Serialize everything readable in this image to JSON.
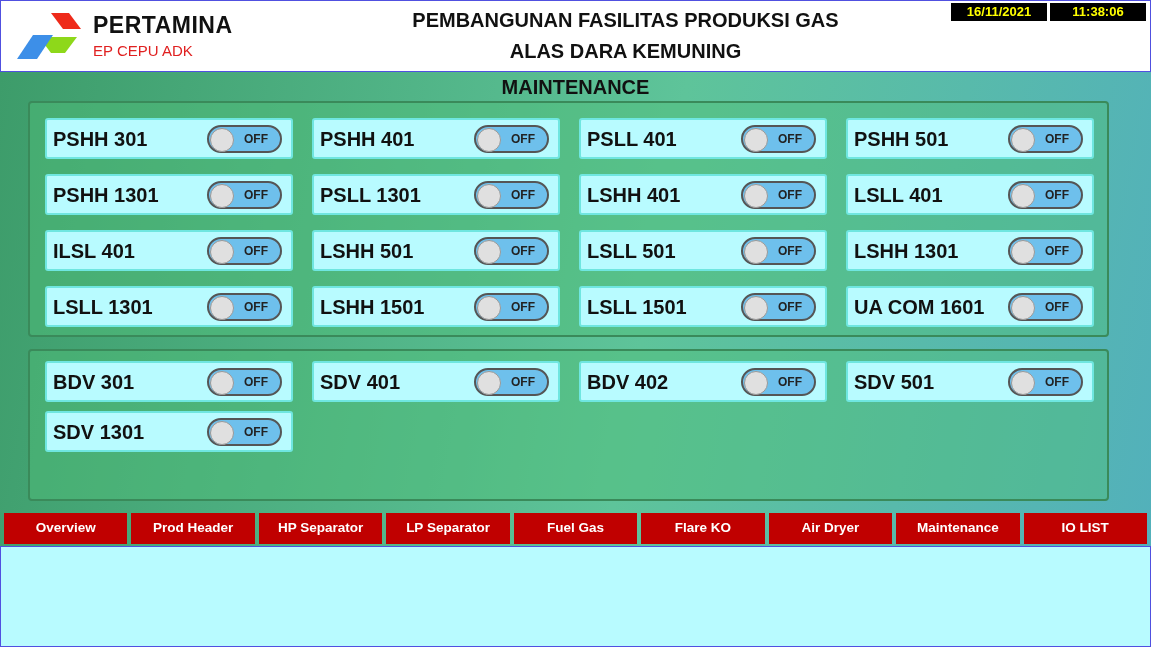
{
  "header": {
    "logo_name": "PERTAMINA",
    "logo_sub": "EP CEPU ADK",
    "title_lines": [
      "PEMBANGUNAN FASILITAS PRODUKSI GAS",
      "ALAS DARA KEMUNING"
    ],
    "date": "16/11/2021",
    "time": "11:38:06"
  },
  "page_title": "MAINTENANCE",
  "panels": [
    {
      "switches": [
        {
          "label": "PSHH 301",
          "on": false,
          "state_text": "OFF"
        },
        {
          "label": "PSHH 401",
          "on": false,
          "state_text": "OFF"
        },
        {
          "label": "PSLL 401",
          "on": false,
          "state_text": "OFF"
        },
        {
          "label": "PSHH 501",
          "on": false,
          "state_text": "OFF"
        },
        {
          "label": "PSHH 1301",
          "on": false,
          "state_text": "OFF"
        },
        {
          "label": "PSLL 1301",
          "on": false,
          "state_text": "OFF"
        },
        {
          "label": "LSHH 401",
          "on": false,
          "state_text": "OFF"
        },
        {
          "label": "LSLL 401",
          "on": false,
          "state_text": "OFF"
        },
        {
          "label": "ILSL 401",
          "on": false,
          "state_text": "OFF"
        },
        {
          "label": "LSHH 501",
          "on": false,
          "state_text": "OFF"
        },
        {
          "label": "LSLL 501",
          "on": false,
          "state_text": "OFF"
        },
        {
          "label": "LSHH 1301",
          "on": false,
          "state_text": "OFF"
        },
        {
          "label": "LSLL 1301",
          "on": false,
          "state_text": "OFF"
        },
        {
          "label": "LSHH 1501",
          "on": false,
          "state_text": "OFF"
        },
        {
          "label": "LSLL 1501",
          "on": false,
          "state_text": "OFF"
        },
        {
          "label": "UA COM 1601",
          "on": false,
          "state_text": "OFF"
        }
      ]
    },
    {
      "switches": [
        {
          "label": "BDV 301",
          "on": false,
          "state_text": "OFF"
        },
        {
          "label": "SDV 401",
          "on": false,
          "state_text": "OFF"
        },
        {
          "label": "BDV 402",
          "on": false,
          "state_text": "OFF"
        },
        {
          "label": "SDV 501",
          "on": false,
          "state_text": "OFF"
        },
        {
          "label": "SDV 1301",
          "on": false,
          "state_text": "OFF"
        }
      ]
    }
  ],
  "nav": [
    "Overview",
    "Prod Header",
    "HP Separator",
    "LP Separator",
    "Fuel Gas",
    "Flare KO",
    "Air Dryer",
    "Maintenance",
    "IO LIST"
  ]
}
